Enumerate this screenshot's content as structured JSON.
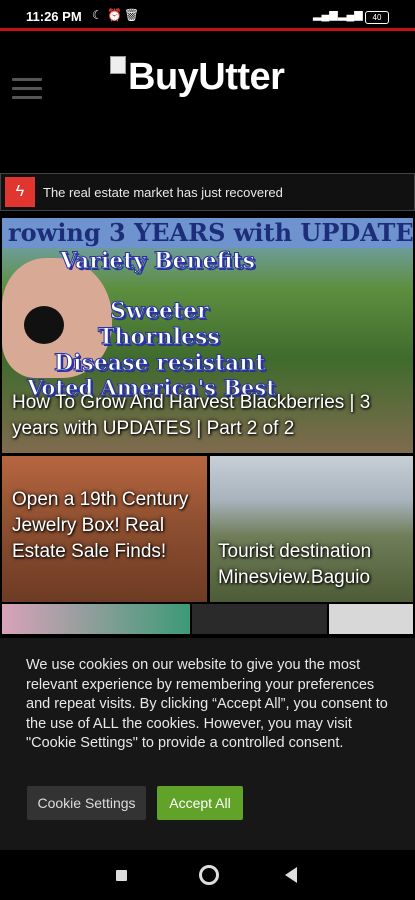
{
  "status_bar": {
    "time": "11:26 PM",
    "battery": "40"
  },
  "header": {
    "logo_text": "BuyUtter"
  },
  "ticker": {
    "text": "The real estate market has just recovered"
  },
  "featured": {
    "banner_text": "rowing 3 YEARS with UPDATES",
    "overlay_lines": [
      "Variety Benefits",
      "Sweeter",
      "Thornless",
      "Disease resistant",
      "Voted America's Best"
    ],
    "caption": "How To Grow And Harvest Blackberries | 3 years with UPDATES | Part 2 of 2"
  },
  "posts": [
    {
      "caption": "Open a 19th Century Jewelry Box! Real Estate Sale Finds!"
    },
    {
      "caption": "Tourist destination Minesview.Baguio"
    }
  ],
  "cookie_banner": {
    "message": "We use cookies on our website to give you the most relevant experience by remembering your preferences and repeat visits. By clicking “Accept All”, you consent to the use of ALL the cookies. However, you may visit \"Cookie Settings\" to provide a controlled consent.",
    "settings_label": "Cookie Settings",
    "accept_label": "Accept All"
  },
  "colors": {
    "accent_red": "#c4121b",
    "accept_green": "#61a229"
  }
}
